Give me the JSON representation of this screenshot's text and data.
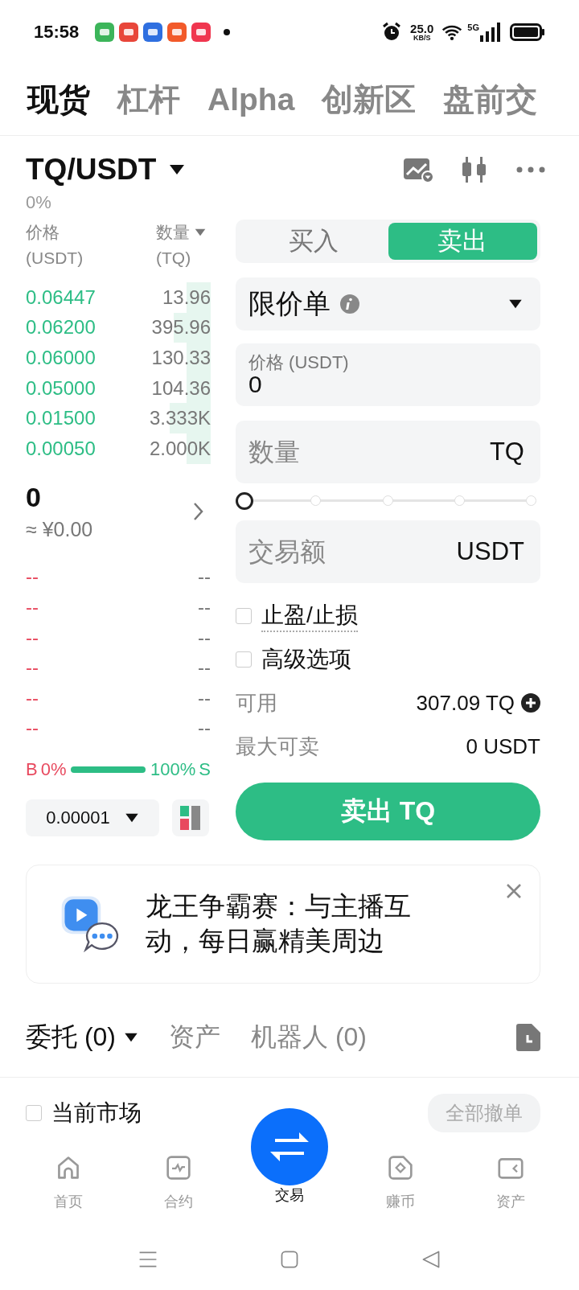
{
  "status_bar": {
    "time": "15:58",
    "net_speed": "25.0",
    "net_unit": "KB/S",
    "network": "5G"
  },
  "market_tabs": [
    {
      "label": "现货",
      "selected": true
    },
    {
      "label": "杠杆",
      "selected": false
    },
    {
      "label": "Alpha",
      "selected": false
    },
    {
      "label": "创新区",
      "selected": false
    },
    {
      "label": "盘前交",
      "selected": false
    }
  ],
  "pair": {
    "symbol": "TQ/USDT",
    "change": "0%"
  },
  "order_book": {
    "price_header": "价格",
    "price_unit": "(USDT)",
    "qty_header": "数量",
    "qty_unit": "(TQ)",
    "asks": [
      {
        "price": "0.06447",
        "qty": "13.96"
      },
      {
        "price": "0.06200",
        "qty": "395.96"
      },
      {
        "price": "0.06000",
        "qty": "130.33"
      },
      {
        "price": "0.05000",
        "qty": "104.36"
      },
      {
        "price": "0.01500",
        "qty": "3.333K"
      },
      {
        "price": "0.00050",
        "qty": "2.000K"
      }
    ],
    "last_price": "0",
    "fiat_price": "≈ ¥0.00",
    "bids": [
      {
        "price": "--",
        "qty": "--"
      },
      {
        "price": "--",
        "qty": "--"
      },
      {
        "price": "--",
        "qty": "--"
      },
      {
        "price": "--",
        "qty": "--"
      },
      {
        "price": "--",
        "qty": "--"
      },
      {
        "price": "--",
        "qty": "--"
      }
    ],
    "ratio": {
      "buy_label": "B",
      "buy_pct": "0%",
      "sell_pct": "100%",
      "sell_label": "S",
      "level": 1
    },
    "precision": "0.00001"
  },
  "trade_panel": {
    "sides": [
      {
        "label": "买入",
        "selected": false
      },
      {
        "label": "卖出",
        "selected": true
      }
    ],
    "order_type": "限价单",
    "price_field": {
      "label": "价格 (USDT)",
      "value": "0"
    },
    "quantity_field": {
      "placeholder": "数量",
      "unit": "TQ"
    },
    "slider": {
      "level": 0
    },
    "amount_field": {
      "placeholder": "交易额",
      "unit": "USDT"
    },
    "options": [
      {
        "label": "止盈/止损",
        "checked": false,
        "kind": "hint"
      },
      {
        "label": "高级选项",
        "checked": false,
        "kind": "plain"
      }
    ],
    "available": {
      "label": "可用",
      "value": "307.09 TQ"
    },
    "max_sell": {
      "label": "最大可卖",
      "value": "0 USDT"
    },
    "submit": "卖出 TQ"
  },
  "banner": {
    "text": "龙王争霸赛：与主播互动，每日赢精美周边"
  },
  "order_tabs": [
    {
      "label": "委托 (0)",
      "selected": true
    },
    {
      "label": "资产",
      "selected": false
    },
    {
      "label": "机器人 (0)",
      "selected": false
    }
  ],
  "filter": {
    "label": "当前市场",
    "checked": false
  },
  "cancel_all": "全部撤单",
  "bottom_nav": [
    {
      "label": "首页",
      "selected": false
    },
    {
      "label": "合约",
      "selected": false
    },
    {
      "label": "交易",
      "selected": true
    },
    {
      "label": "赚币",
      "selected": false
    },
    {
      "label": "资产",
      "selected": false
    }
  ]
}
